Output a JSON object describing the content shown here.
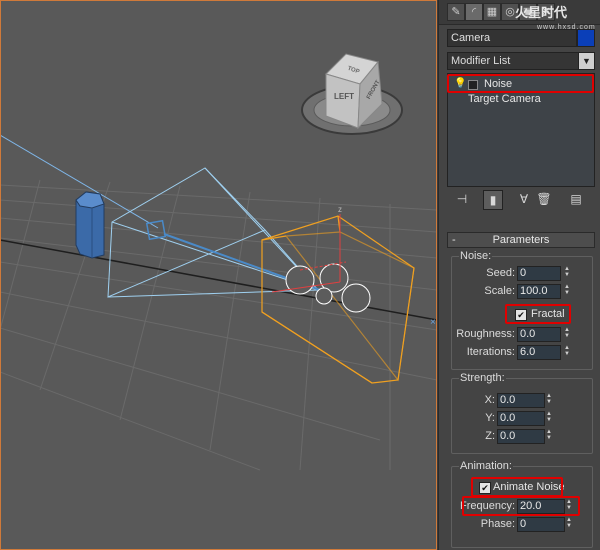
{
  "viewport": {
    "label": "viewport-perspective",
    "viewcube": {
      "left_face": "LEFT",
      "front_face": "FRONT",
      "top_face": "TOP"
    },
    "border_color": "#d07a3a",
    "accent_selected": "#f0a020",
    "camera_color": "#4a8ac8",
    "mesh_color": "#3b6aa8"
  },
  "panel": {
    "tabs": [
      "create-icon",
      "modify-icon",
      "hierarchy-icon",
      "motion-icon",
      "display-icon",
      "utilities-icon"
    ],
    "logo_text": "火星时代",
    "logo_url": "www.hxsd.com",
    "object_name": "Camera",
    "object_color": "#0b3fb8",
    "modifier_list_label": "Modifier List",
    "stack_items": [
      {
        "label": "Noise"
      },
      {
        "label": "Target Camera"
      }
    ],
    "tool_icons": [
      "pin-stack-icon",
      "show-end-result-icon",
      "make-unique-icon",
      "remove-modifier-icon",
      "configure-modifier-sets-icon"
    ],
    "rollout_title": "Parameters",
    "rollout_toggle": "-",
    "noise": {
      "group_label": "Noise:",
      "seed_label": "Seed:",
      "seed_value": "0",
      "scale_label": "Scale:",
      "scale_value": "100.0",
      "fractal_label": "Fractal",
      "fractal_checked": true,
      "roughness_label": "Roughness:",
      "roughness_value": "0.0",
      "iterations_label": "Iterations:",
      "iterations_value": "6.0"
    },
    "strength": {
      "group_label": "Strength:",
      "x_label": "X:",
      "x_value": "0.0",
      "y_label": "Y:",
      "y_value": "0.0",
      "z_label": "Z:",
      "z_value": "0.0"
    },
    "animation": {
      "group_label": "Animation:",
      "animate_noise_label": "Animate Noise",
      "animate_noise_checked": true,
      "frequency_label": "Frequency:",
      "frequency_value": "20.0",
      "phase_label": "Phase:",
      "phase_value": "0"
    },
    "highlight_color": "#e00000"
  }
}
